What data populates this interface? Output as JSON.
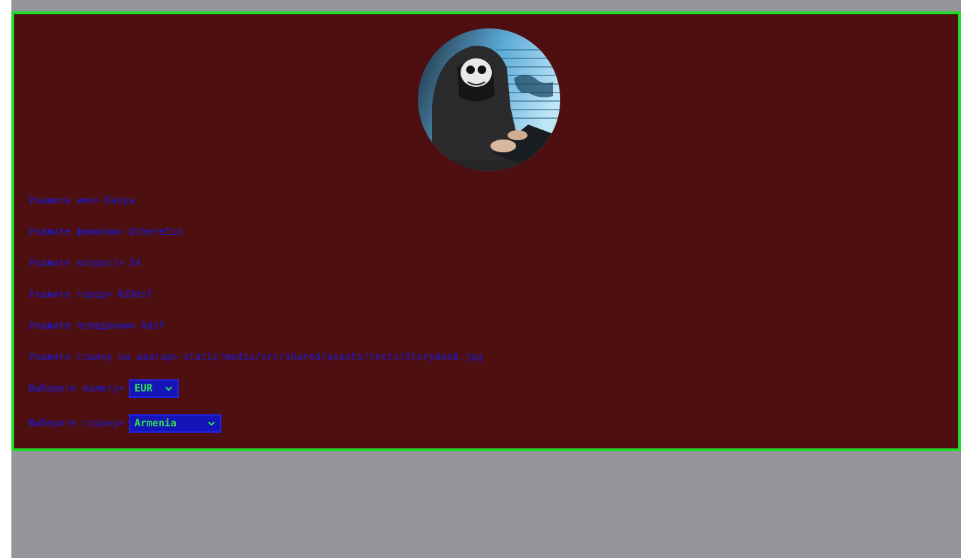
{
  "profile": {
    "avatar_alt": "avatar",
    "fields": [
      {
        "label": "Укажите имя>",
        "value": "Danya"
      },
      {
        "label": "Укажите фамилию>",
        "value": "Ocheretin"
      },
      {
        "label": "Укажите возраст>",
        "value": "24"
      },
      {
        "label": "Укажите город>",
        "value": "ASDdsf"
      },
      {
        "label": "Укажите псевдоним>",
        "value": "Adsf"
      },
      {
        "label": "Укажите ссылку на аватар>",
        "value": "static/media/src/shared/assets/tests/Storybook.jpg"
      }
    ],
    "currency": {
      "label": "Выберите валюту>",
      "selected": "EUR"
    },
    "country": {
      "label": "Выберите страну>",
      "selected": "Armenia"
    }
  },
  "colors": {
    "card_bg": "#4d0f10",
    "card_border": "#1fdc2b",
    "text": "#1a1adc",
    "select_bg": "#1414b8",
    "select_text": "#2fe04a",
    "page_bg": "#969599"
  }
}
